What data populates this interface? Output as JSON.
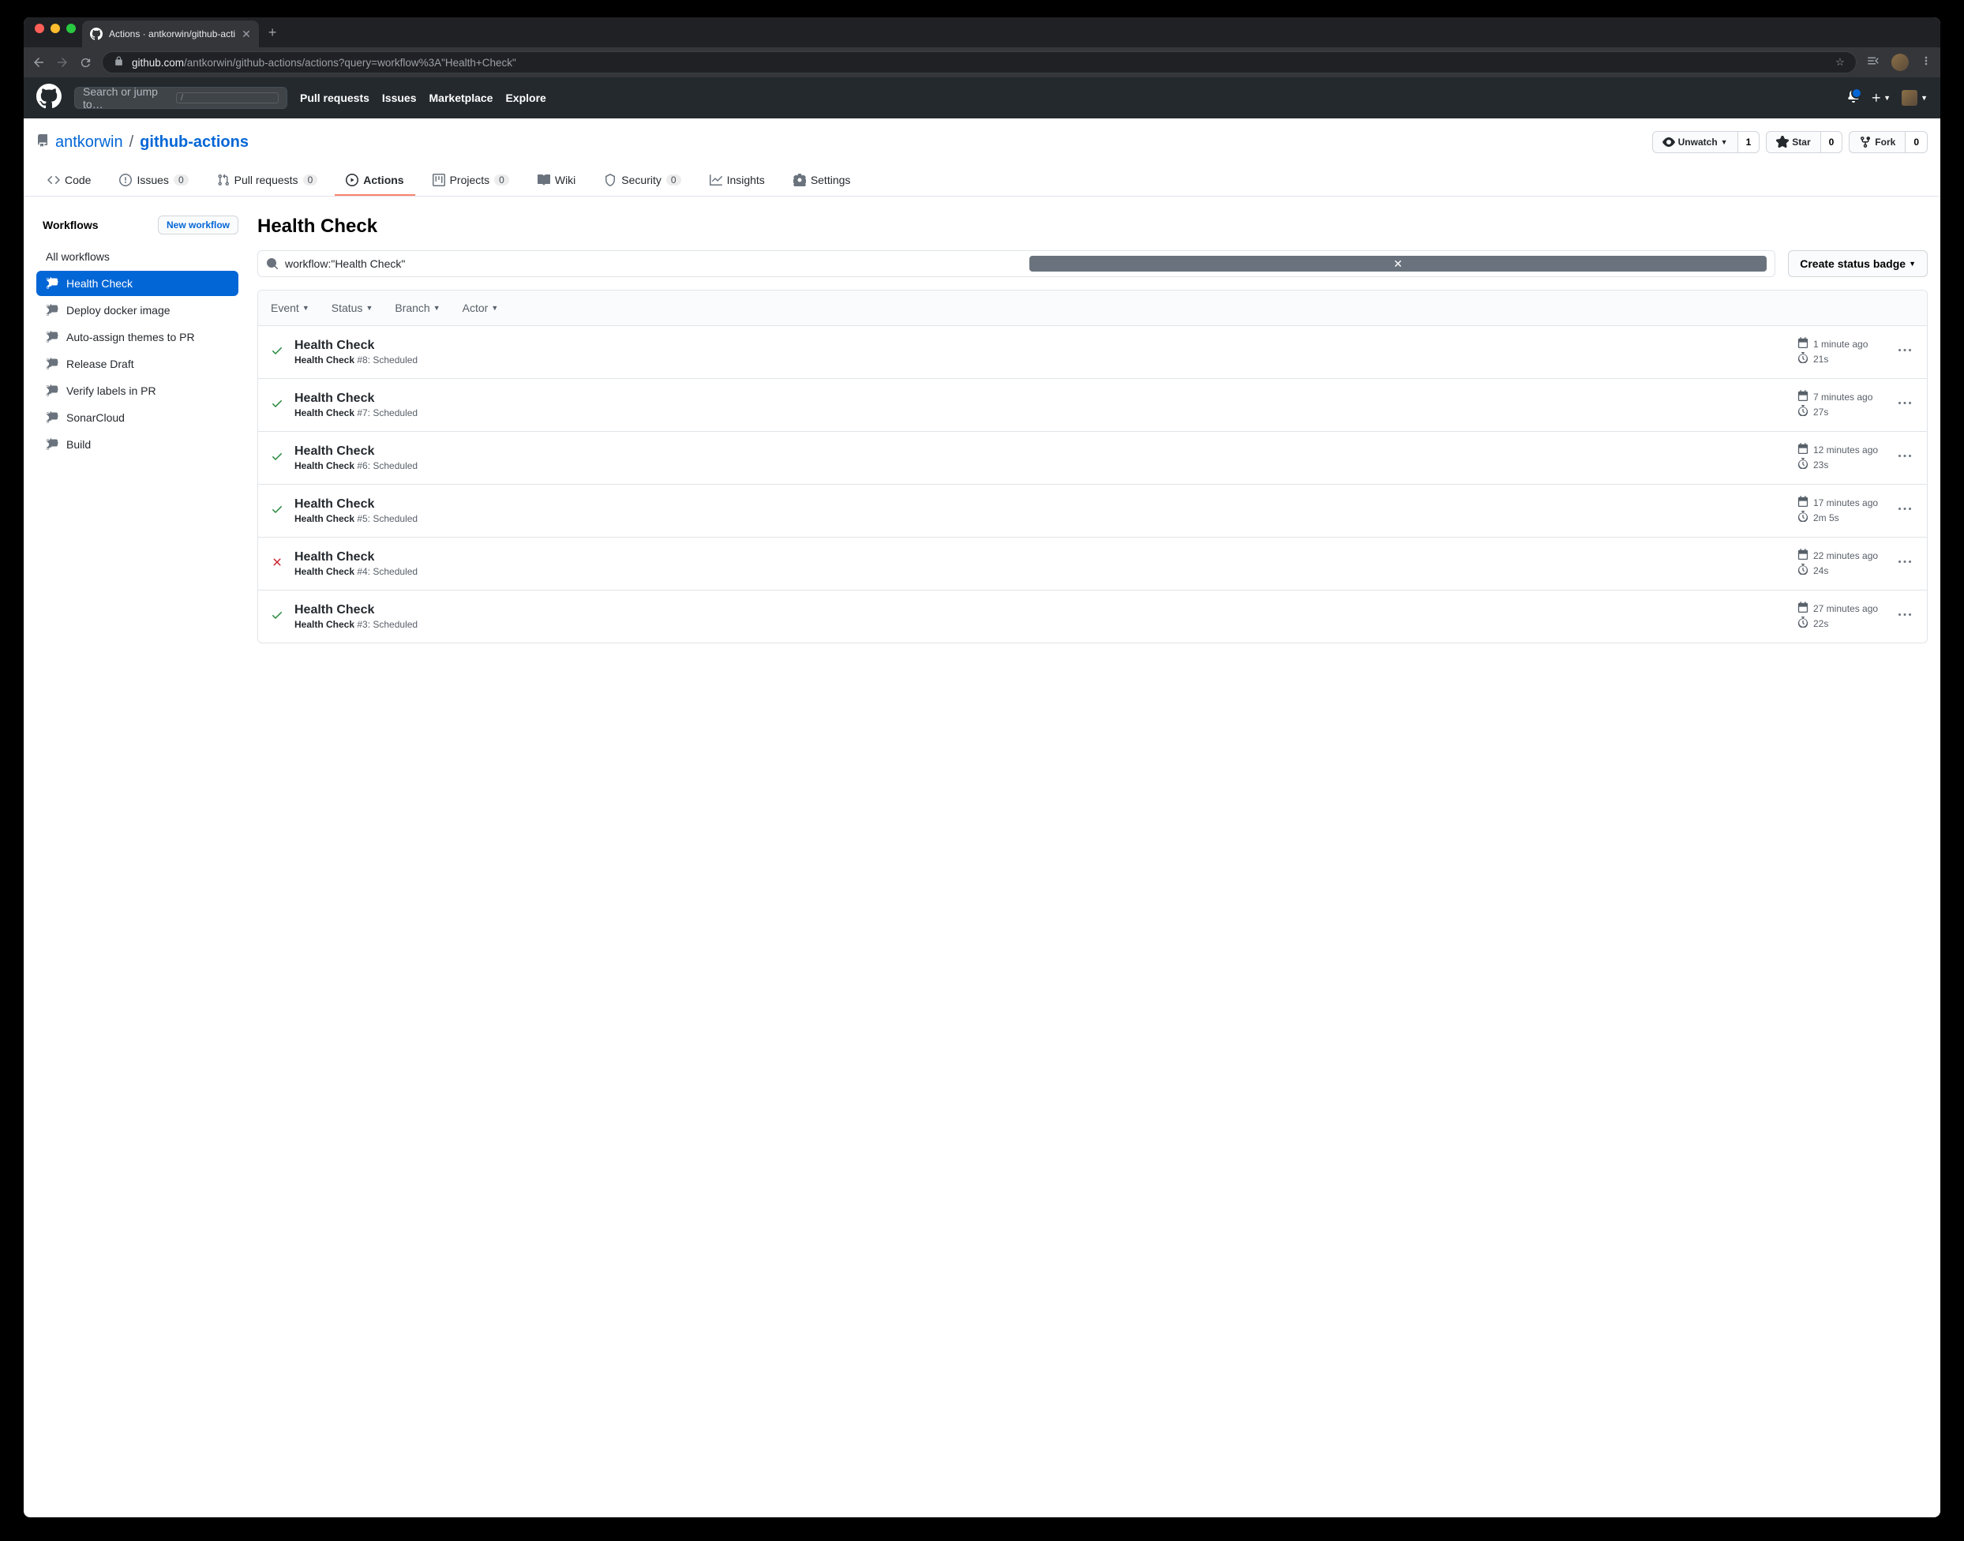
{
  "browser": {
    "tab_title": "Actions · antkorwin/github-acti",
    "url_domain": "github.com",
    "url_path": "/antkorwin/github-actions/actions?query=workflow%3A\"Health+Check\""
  },
  "gh_header": {
    "search_placeholder": "Search or jump to…",
    "nav": [
      "Pull requests",
      "Issues",
      "Marketplace",
      "Explore"
    ]
  },
  "repo": {
    "owner": "antkorwin",
    "name": "github-actions",
    "watch_label": "Unwatch",
    "watch_count": "1",
    "star_label": "Star",
    "star_count": "0",
    "fork_label": "Fork",
    "fork_count": "0"
  },
  "tabs": {
    "code": "Code",
    "issues": "Issues",
    "issues_count": "0",
    "prs": "Pull requests",
    "prs_count": "0",
    "actions": "Actions",
    "projects": "Projects",
    "projects_count": "0",
    "wiki": "Wiki",
    "security": "Security",
    "security_count": "0",
    "insights": "Insights",
    "settings": "Settings"
  },
  "sidebar": {
    "title": "Workflows",
    "new_btn": "New workflow",
    "all": "All workflows",
    "items": [
      "Health Check",
      "Deploy docker image",
      "Auto-assign themes to PR",
      "Release Draft",
      "Verify labels in PR",
      "SonarCloud",
      "Build"
    ]
  },
  "main": {
    "title": "Health Check",
    "filter_value": "workflow:\"Health Check\"",
    "badge_btn": "Create status badge",
    "filters": [
      "Event",
      "Status",
      "Branch",
      "Actor"
    ]
  },
  "runs": [
    {
      "status": "success",
      "title": "Health Check",
      "workflow": "Health Check",
      "num": "#8",
      "trigger": "Scheduled",
      "time": "1 minute ago",
      "duration": "21s"
    },
    {
      "status": "success",
      "title": "Health Check",
      "workflow": "Health Check",
      "num": "#7",
      "trigger": "Scheduled",
      "time": "7 minutes ago",
      "duration": "27s"
    },
    {
      "status": "success",
      "title": "Health Check",
      "workflow": "Health Check",
      "num": "#6",
      "trigger": "Scheduled",
      "time": "12 minutes ago",
      "duration": "23s"
    },
    {
      "status": "success",
      "title": "Health Check",
      "workflow": "Health Check",
      "num": "#5",
      "trigger": "Scheduled",
      "time": "17 minutes ago",
      "duration": "2m 5s"
    },
    {
      "status": "failure",
      "title": "Health Check",
      "workflow": "Health Check",
      "num": "#4",
      "trigger": "Scheduled",
      "time": "22 minutes ago",
      "duration": "24s"
    },
    {
      "status": "success",
      "title": "Health Check",
      "workflow": "Health Check",
      "num": "#3",
      "trigger": "Scheduled",
      "time": "27 minutes ago",
      "duration": "22s"
    }
  ]
}
